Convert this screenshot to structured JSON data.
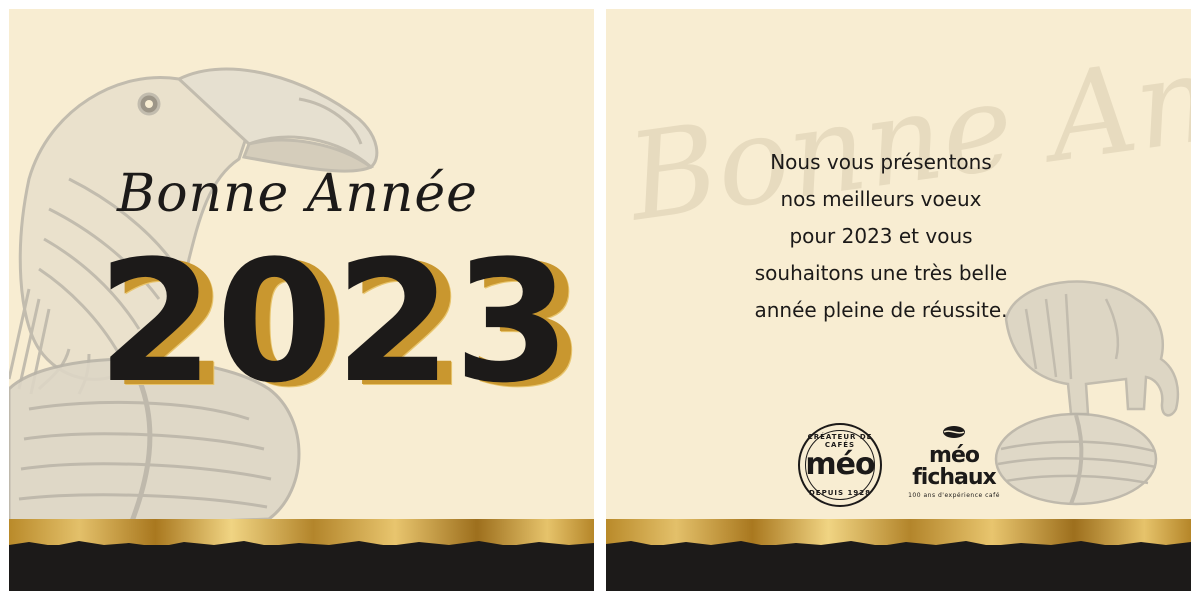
{
  "left_card": {
    "script_title": "Bonne Année",
    "year": "2023"
  },
  "right_card": {
    "watermark": "Bonne Année",
    "message_lines": [
      "Nous vous présentons",
      "nos meilleurs voeux",
      "pour 2023 et vous",
      "souhaitons une très belle",
      "année pleine de réussite."
    ],
    "logo_meo": {
      "top_text": "CRÉATEUR DE CAFÉS",
      "word": "méo",
      "bottom_text": "DEPUIS 1928"
    },
    "logo_fichaux": {
      "line1": "méo",
      "line2": "fichaux",
      "tagline": "100 ans d'expérience café"
    }
  },
  "colors": {
    "paper": "#f8edd2",
    "ink": "#1c1a19",
    "gold": "#c9972f",
    "engraving": "#b9b4a8"
  },
  "icons": {
    "left_illustration": "toucan-on-coffee-bean",
    "right_illustration": "elephant-on-coffee-bean"
  }
}
